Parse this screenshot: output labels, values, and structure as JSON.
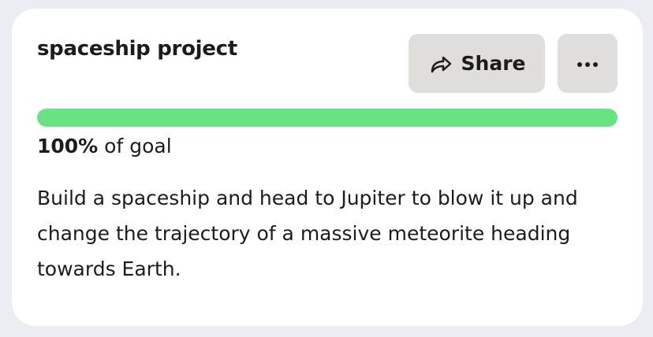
{
  "card": {
    "title": "spaceship project",
    "share_label": "Share",
    "share_icon": "share-arrow-icon",
    "more_icon": "more-horizontal-icon",
    "progress": {
      "percent": 100,
      "percent_label": "100%",
      "suffix": " of goal",
      "fill_color": "#67e383"
    },
    "description": "Build a spaceship and head to Jupiter to blow it up and change the trajectory of a massive meteorite heading towards Earth."
  }
}
